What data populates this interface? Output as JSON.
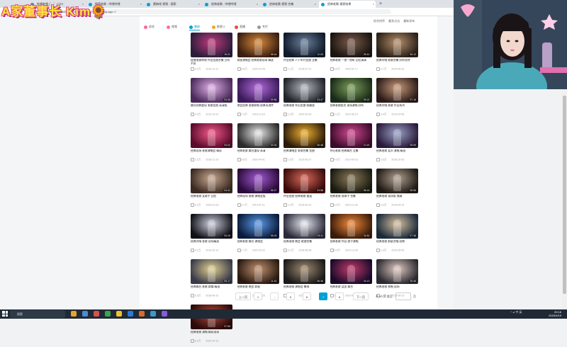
{
  "overlay": {
    "title": "A家董事长 Kim🌻"
  },
  "browser": {
    "tabs": [
      {
        "label": "哔哩哔哩 (゜-゜)つロ",
        "color": "#00a1d6"
      },
      {
        "label": "搜索结果 - 哔哩哔哩",
        "color": "#00a1d6"
      },
      {
        "label": "黄梅戏 视频 - 搜索",
        "color": "#00a1d6"
      },
      {
        "label": "经典老歌 - 哔哩哔哩",
        "color": "#00a1d6"
      },
      {
        "label": "经典老歌 视频 合集",
        "color": "#00a1d6"
      },
      {
        "label": "经典老歌-搜索结果",
        "color": "#00a1d6"
      }
    ],
    "new_tab": "+",
    "url": "search.bilibili.com/video?keyword=经典老歌&page=7"
  },
  "nav": {
    "items": [
      {
        "label": "综合",
        "color": "#ff6699"
      },
      {
        "label": "视频",
        "color": "#fb7299"
      },
      {
        "label": "番剧",
        "color": "#00a1d6"
      },
      {
        "label": "影视 0",
        "color": "#f5a623"
      },
      {
        "label": "直播",
        "color": "#e74c3c"
      },
      {
        "label": "专栏",
        "color": "#999999"
      }
    ],
    "sort": [
      "综合排序",
      "最多点击",
      "最新发布"
    ]
  },
  "videos": [
    {
      "title": "经典老歌串烧 怀旧金曲合集 百听不厌",
      "views": "3.2万",
      "date": "2019-12-11",
      "duration": "15:21",
      "c1": "#2a1d3a",
      "c2": "#c23a7e"
    },
    {
      "title": "群星演唱会 经典老歌现场 精选",
      "views": "5.8万",
      "date": "2020-03-05",
      "duration": "08:44",
      "c1": "#3a1e10",
      "c2": "#d78a3a"
    },
    {
      "title": "怀旧经典 八十年代金曲 全集",
      "views": "1.1万",
      "date": "2018-07-21",
      "duration": "12:03",
      "c1": "#101a2a",
      "c2": "#6a7f9a"
    },
    {
      "title": "经典老歌 一首一首听 回忆满满",
      "views": "9.6万",
      "date": "2020-01-17",
      "duration": "25:10",
      "c1": "#1a1410",
      "c2": "#7a5a4a"
    },
    {
      "title": "经典对唱 老歌合集 好听到哭",
      "views": "2.7万",
      "date": "2019-05-30",
      "duration": "06:12",
      "c1": "#2a2018",
      "c2": "#b7906a"
    },
    {
      "title": "舞台经典重现 老歌金曲 高清版",
      "views": "4.5万",
      "date": "2019-10-02",
      "duration": "04:36",
      "c1": "#4a2a5a",
      "c2": "#e0b0e6"
    },
    {
      "title": "晚会经典 老歌联唱 经典永流传",
      "views": "7.3万",
      "date": "2018-12-24",
      "duration": "09:58",
      "c1": "#3a1a5a",
      "c2": "#b26ad8"
    },
    {
      "title": "经典老歌 怀旧金曲 收藏版",
      "views": "1.9万",
      "date": "2020-02-09",
      "duration": "03:47",
      "c1": "#20242a",
      "c2": "#b4b8be"
    },
    {
      "title": "经典老歌组合 现场演唱 好听",
      "views": "6.1万",
      "date": "2019-08-14",
      "duration": "05:22",
      "c1": "#1a2a18",
      "c2": "#7a9e5a"
    },
    {
      "title": "经典对唱 老歌 怀旧系列",
      "views": "3.4万",
      "date": "2019-04-08",
      "duration": "07:15",
      "c1": "#2a1a18",
      "c2": "#c89a7a"
    },
    {
      "title": "经典现场 老歌演唱会 精彩",
      "views": "2.2万",
      "date": "2018-11-19",
      "duration": "04:02",
      "c1": "#5a0a2a",
      "c2": "#f25a8a"
    },
    {
      "title": "经典老歌 舞台重现 高清",
      "views": "8.8万",
      "date": "2020-04-01",
      "duration": "03:33",
      "c1": "#2a2a2a",
      "c2": "#e8e8e8"
    },
    {
      "title": "经典演唱会 老歌合集 金曲",
      "views": "1.5万",
      "date": "2019-06-27",
      "duration": "06:48",
      "c1": "#2a1a0a",
      "c2": "#f0b030"
    },
    {
      "title": "怀旧老歌 经典舞台 全集",
      "views": "4.9万",
      "date": "2019-09-16",
      "duration": "10:20",
      "c1": "#3a0a2a",
      "c2": "#d04a90"
    },
    {
      "title": "经典老歌 女声 演唱 精选",
      "views": "2.6万",
      "date": "2018-10-05",
      "duration": "05:09",
      "c1": "#2a1a3a",
      "c2": "#9aa2c8"
    },
    {
      "title": "经典老歌 女歌手 回忆",
      "views": "5.2万",
      "date": "2020-01-03",
      "duration": "04:41",
      "c1": "#3a2a20",
      "c2": "#c8a890"
    },
    {
      "title": "经典现场 老歌 演唱会版",
      "views": "3.7万",
      "date": "2019-07-11",
      "duration": "06:27",
      "c1": "#2a0a3a",
      "c2": "#a25ad0"
    },
    {
      "title": "怀旧金曲 经典老歌 重温",
      "views": "1.3万",
      "date": "2018-09-22",
      "duration": "03:58",
      "c1": "#3a0a0a",
      "c2": "#d86a5a"
    },
    {
      "title": "经典老歌 男歌手 合集",
      "views": "6.4万",
      "date": "2019-11-28",
      "duration": "08:16",
      "c1": "#1a1a10",
      "c2": "#8a7a5a"
    },
    {
      "title": "经典老歌 现场版 收藏",
      "views": "2.9万",
      "date": "2019-03-14",
      "duration": "05:55",
      "c1": "#201a14",
      "c2": "#b0a090"
    },
    {
      "title": "经典对唱 老歌 现场精选",
      "views": "4.1万",
      "date": "2019-02-19",
      "duration": "04:29",
      "c1": "#101018",
      "c2": "#d0d0e0"
    },
    {
      "title": "经典老歌 舞台 演唱会",
      "views": "7.7万",
      "date": "2020-03-22",
      "duration": "06:03",
      "c1": "#0a1a3a",
      "c2": "#5a9ae8"
    },
    {
      "title": "经典老歌 晚会 歌曲合集",
      "views": "3.1万",
      "date": "2018-08-08",
      "duration": "09:11",
      "c1": "#2a2a3a",
      "c2": "#e8e8f0"
    },
    {
      "title": "经典老歌 怀旧 歌手演唱",
      "views": "5.5万",
      "date": "2019-12-30",
      "duration": "04:50",
      "c1": "#3a1a0a",
      "c2": "#f08a3a"
    },
    {
      "title": "经典老歌 群星合唱 经典",
      "views": "2.3万",
      "date": "2019-05-06",
      "duration": "07:38",
      "c1": "#1a2a3a",
      "c2": "#d8c0a0"
    },
    {
      "title": "经典舞台 老歌 群舞 精选",
      "views": "6.9万",
      "date": "2018-06-15",
      "duration": "05:17",
      "c1": "#3a3a4a",
      "c2": "#e0d090"
    },
    {
      "title": "经典老歌 晚会 群星",
      "views": "1.8万",
      "date": "2019-10-25",
      "duration": "11:42",
      "c1": "#2a1a10",
      "c2": "#c09070"
    },
    {
      "title": "经典老歌 演唱会 集锦",
      "views": "4.3万",
      "date": "2020-02-27",
      "duration": "06:36",
      "c1": "#1a1a1a",
      "c2": "#a08a70"
    },
    {
      "title": "经典老歌 女团 舞台",
      "views": "3.6万",
      "date": "2019-01-12",
      "duration": "04:13",
      "c1": "#1a0a2a",
      "c2": "#c03a6a"
    },
    {
      "title": "经典老歌 独唱 现场",
      "views": "2.1万",
      "date": "2018-05-19",
      "duration": "05:46",
      "c1": "#2a2a30",
      "c2": "#e0c8c0"
    },
    {
      "title": "经典老歌 演唱 精彩现场",
      "views": "8.2万",
      "date": "2020-04-10",
      "duration": "07:59",
      "c1": "#2a0a0a",
      "c2": "#b04a3a"
    }
  ],
  "pagination": {
    "first": "上一页",
    "pages": [
      "1",
      "...",
      "5",
      "6",
      "7",
      "8"
    ],
    "current": "7",
    "next": "下一页",
    "goto_label": "共 50 页 跳至",
    "page_suffix": "页"
  },
  "taskbar": {
    "search_placeholder": "搜索",
    "icons": [
      "#e8a32a",
      "#4a8ad8",
      "#d8534a",
      "#3aa64a",
      "#f0c030",
      "#2a7ad8",
      "#d86a2a",
      "#3a9ac8",
      "#8a5ad8"
    ],
    "tray": "^ ⊿ 中 英",
    "time": "20:18",
    "date": "2020/4/19"
  }
}
